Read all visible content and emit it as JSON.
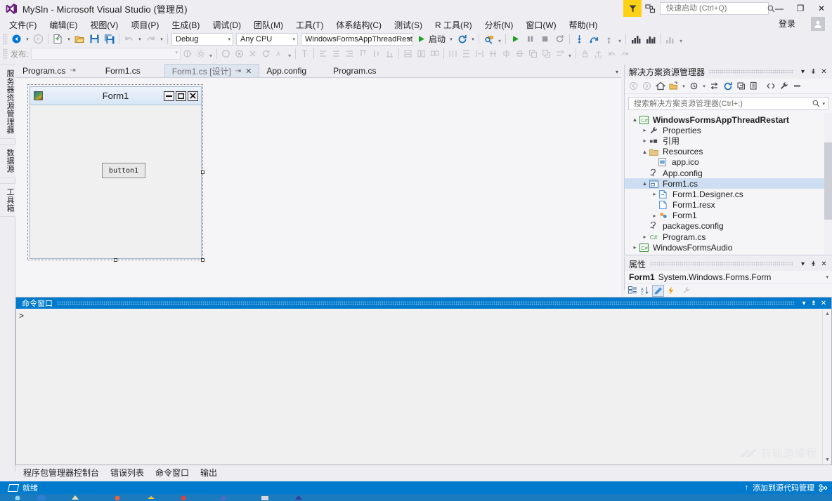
{
  "titlebar": {
    "logo_icon": "visual-studio-logo-icon",
    "title": "MySln - Microsoft Visual Studio (管理员)",
    "quick_launch_placeholder": "快速启动 (Ctrl+Q)",
    "quick_launch_value": "",
    "search_icon": "search-icon",
    "flag_icon": "feedback-flag-icon",
    "feedback_icon": "send-feedback-icon",
    "minimize": "—",
    "restore": "❐",
    "close": "✕",
    "signin_label": "登录",
    "account_icon": "account-icon"
  },
  "menubar": {
    "items": [
      "文件(F)",
      "编辑(E)",
      "视图(V)",
      "项目(P)",
      "生成(B)",
      "调试(D)",
      "团队(M)",
      "工具(T)",
      "体系结构(C)",
      "测试(S)",
      "R 工具(R)",
      "分析(N)",
      "窗口(W)",
      "帮助(H)"
    ]
  },
  "toolbar": {
    "back_icon": "navigate-backward-icon",
    "forward_icon": "navigate-forward-icon",
    "new_project_icon": "new-project-icon",
    "open_file_icon": "open-file-icon",
    "save_icon": "save-icon",
    "save_all_icon": "save-all-icon",
    "undo_icon": "undo-icon",
    "redo_icon": "redo-icon",
    "config_combo": "Debug",
    "platform_combo": "Any CPU",
    "startup_combo": "WindowsFormsAppThreadResta",
    "start_label": "启动",
    "refresh_icon": "restart-icon",
    "find_icon": "find-in-files-icon",
    "continue_icon": "continue-icon",
    "pause_icon": "pause-icon",
    "stop_icon": "stop-icon",
    "restart_icon": "restart-debug-icon",
    "step_into_icon": "step-into-icon",
    "step_over_icon": "step-over-icon",
    "step_out_icon": "step-out-icon",
    "diag_icon": "diagnostics-icon",
    "perf_icon": "performance-icon",
    "chart_icon": "chart-icon"
  },
  "toolbar2": {
    "publish_label": "发布:",
    "publish_value": "",
    "icons": [
      "publish-icon",
      "settings-icon",
      "overflow-icon",
      "add-icon",
      "remove-icon",
      "delete-icon",
      "refresh-icon",
      "rename-icon",
      "align-icon",
      "align-left-icon",
      "align-center-icon",
      "align-right-icon",
      "align-top-icon",
      "align-middle-icon",
      "align-bottom-icon",
      "make-same-width-icon",
      "make-same-height-icon",
      "make-same-size-icon",
      "tab-order-icon",
      "horizontal-spacing-icon",
      "vertical-spacing-icon",
      "center-horizontally-icon",
      "center-vertically-icon",
      "bring-to-front-icon",
      "send-to-back-icon",
      "lock-controls-icon",
      "undo-icon",
      "redo-icon"
    ]
  },
  "left_tabs": [
    {
      "label": "服务器资源管理器",
      "name": "server-explorer-tab"
    },
    {
      "label": "数据源",
      "name": "data-sources-tab"
    },
    {
      "label": "工具箱",
      "name": "toolbox-tab"
    }
  ],
  "doc_tabs": [
    {
      "label": "Program.cs",
      "active": false,
      "pinned": true,
      "closable": false
    },
    {
      "label": "Form1.cs",
      "active": false,
      "pinned": false,
      "closable": false
    },
    {
      "label": "Form1.cs [设计]",
      "active": true,
      "pinned": true,
      "closable": true
    },
    {
      "label": "App.config",
      "active": false,
      "pinned": false,
      "closable": false
    },
    {
      "label": "Program.cs",
      "active": false,
      "pinned": false,
      "closable": false
    }
  ],
  "designer": {
    "form_icon": "form-app-icon",
    "form_title": "Form1",
    "minimize_glyph": "—",
    "maximize_glyph": "❐",
    "close_glyph": "✕",
    "button_text": "button1"
  },
  "solution_explorer": {
    "title": "解决方案资源管理器",
    "header_icons": [
      "chevron-down-icon",
      "pin-icon",
      "close-icon"
    ],
    "toolbar_icons": [
      "back-icon",
      "forward-icon",
      "home-icon",
      "switch-views-icon",
      "pending-changes-icon",
      "sync-with-active-document-icon",
      "refresh-icon",
      "collapse-all-icon",
      "show-all-files-icon",
      "view-code-icon",
      "properties-icon",
      "preview-selected-items-icon"
    ],
    "search_placeholder": "搜索解决方案资源管理器(Ctrl+;)",
    "search_value": "",
    "search_icon": "search-icon",
    "tree": [
      {
        "label": "WindowsFormsAppThreadRestart",
        "indent": 0,
        "twisty": "expanded",
        "icon": "csharp-project-icon",
        "bold": true,
        "selected": false
      },
      {
        "label": "Properties",
        "indent": 1,
        "twisty": "collapsed",
        "icon": "properties-wrench-icon",
        "bold": false,
        "selected": false
      },
      {
        "label": "引用",
        "indent": 1,
        "twisty": "collapsed",
        "icon": "references-icon",
        "bold": false,
        "selected": false
      },
      {
        "label": "Resources",
        "indent": 1,
        "twisty": "expanded",
        "icon": "folder-icon",
        "bold": false,
        "selected": false
      },
      {
        "label": "app.ico",
        "indent": 2,
        "twisty": "none",
        "icon": "image-file-icon",
        "bold": false,
        "selected": false
      },
      {
        "label": "App.config",
        "indent": 1,
        "twisty": "none",
        "icon": "config-file-icon",
        "bold": false,
        "selected": false
      },
      {
        "label": "Form1.cs",
        "indent": 1,
        "twisty": "expanded",
        "icon": "form-file-icon",
        "bold": false,
        "selected": true
      },
      {
        "label": "Form1.Designer.cs",
        "indent": 2,
        "twisty": "collapsed",
        "icon": "csharp-file-icon",
        "bold": false,
        "selected": false
      },
      {
        "label": "Form1.resx",
        "indent": 2,
        "twisty": "none",
        "icon": "resx-file-icon",
        "bold": false,
        "selected": false
      },
      {
        "label": "Form1",
        "indent": 2,
        "twisty": "collapsed",
        "icon": "class-icon",
        "bold": false,
        "selected": false
      },
      {
        "label": "packages.config",
        "indent": 1,
        "twisty": "none",
        "icon": "config-file-icon",
        "bold": false,
        "selected": false
      },
      {
        "label": "Program.cs",
        "indent": 1,
        "twisty": "collapsed",
        "icon": "csharp-file-icon",
        "bold": false,
        "selected": false
      },
      {
        "label": "WindowsFormsAudio",
        "indent": 0,
        "twisty": "collapsed",
        "icon": "csharp-project-icon",
        "bold": false,
        "selected": false
      }
    ]
  },
  "properties": {
    "title": "属性",
    "header_icons": [
      "chevron-down-icon",
      "pin-icon",
      "close-icon"
    ],
    "object_name": "Form1",
    "object_type": "System.Windows.Forms.Form",
    "toolbar_icons": [
      "categorized-icon",
      "alphabetical-icon",
      "properties-icon",
      "events-icon",
      "property-pages-icon"
    ]
  },
  "command_window": {
    "title": "命令窗口",
    "header_icons": [
      "chevron-down-icon",
      "pin-icon",
      "close-icon"
    ],
    "prompt": ">",
    "content": "",
    "watermark": "智能造编程"
  },
  "dock_tabs": [
    "程序包管理器控制台",
    "错误列表",
    "命令窗口",
    "输出"
  ],
  "statusbar": {
    "ready_icon": "ready-icon",
    "ready_text": "就绪",
    "source_control_arrow": "↑",
    "source_control_text": "添加到源代码管理",
    "source_control_icon": "source-control-icon"
  },
  "colors": {
    "accent": "#007acc",
    "chrome": "#eeeef2",
    "panel": "#f5f5f7",
    "selection": "#cedef2",
    "flag_yellow": "#fcd116",
    "taskbar": "#1a7bbf"
  }
}
